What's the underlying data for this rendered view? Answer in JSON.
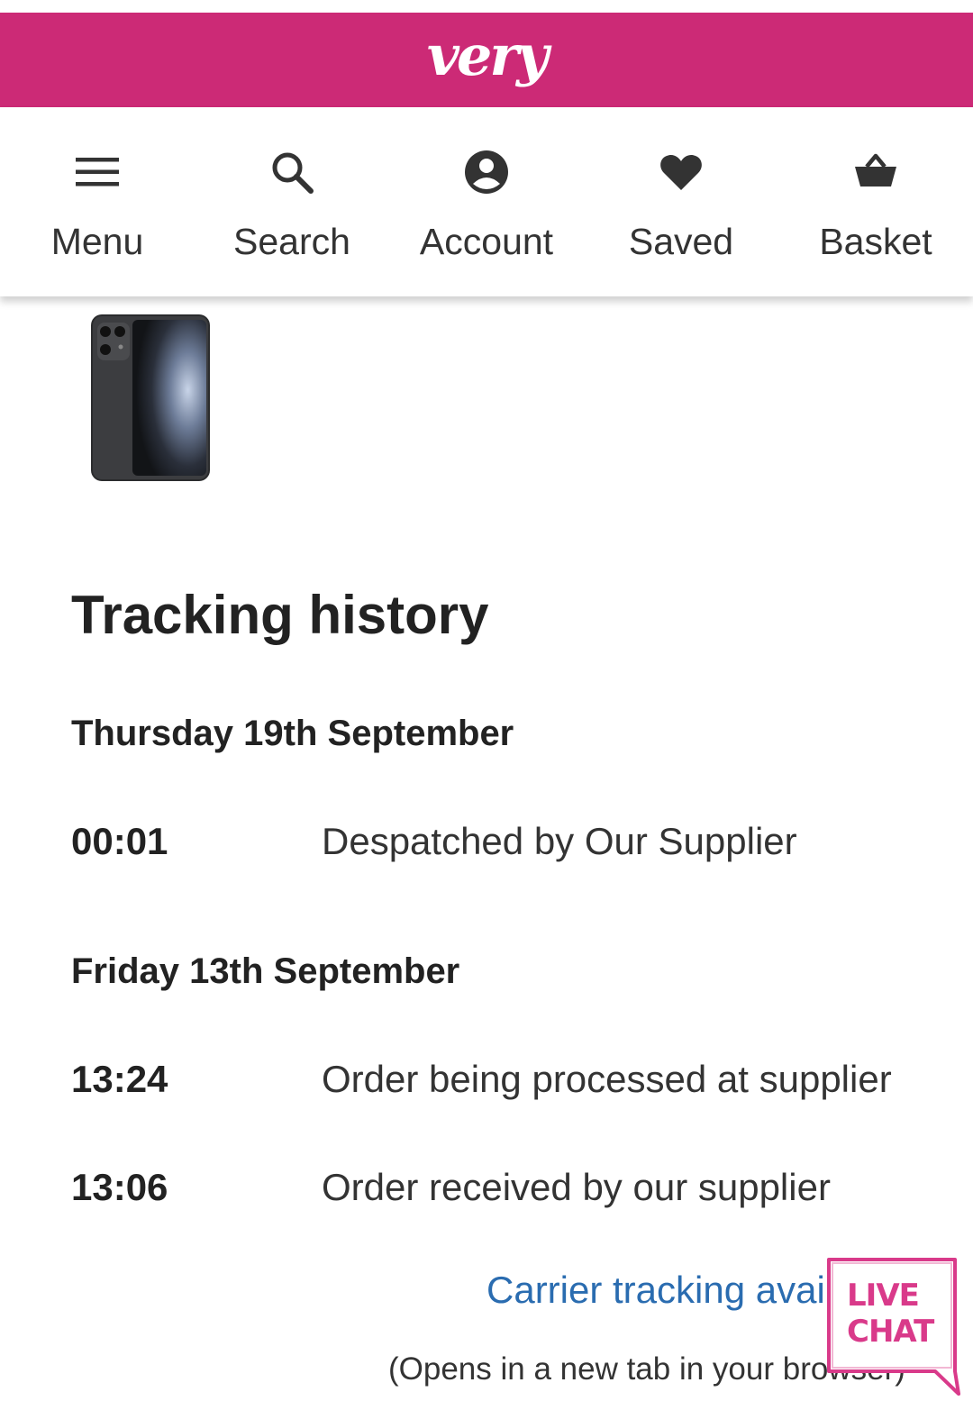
{
  "header": {
    "logo_text": "very",
    "brand_color": "#cc2a76"
  },
  "nav": {
    "items": [
      {
        "label": "Menu",
        "icon": "menu-icon"
      },
      {
        "label": "Search",
        "icon": "search-icon"
      },
      {
        "label": "Account",
        "icon": "account-icon"
      },
      {
        "label": "Saved",
        "icon": "heart-icon"
      },
      {
        "label": "Basket",
        "icon": "basket-icon"
      }
    ]
  },
  "product": {
    "image": "phone-product-image"
  },
  "tracking": {
    "heading": "Tracking history",
    "days": [
      {
        "date": "Thursday 19th September",
        "events": [
          {
            "time": "00:01",
            "text": "Despatched by Our Supplier"
          }
        ]
      },
      {
        "date": "Friday 13th September",
        "events": [
          {
            "time": "13:24",
            "text": "Order being processed at supplier"
          },
          {
            "time": "13:06",
            "text": "Order received by our supplier"
          }
        ]
      }
    ],
    "carrier_link": "Carrier tracking avai",
    "opens_note": "(Opens in a new tab in your browser)"
  },
  "live_chat": {
    "line1": "LIVE",
    "line2": "CHAT",
    "color": "#d93a8a"
  }
}
